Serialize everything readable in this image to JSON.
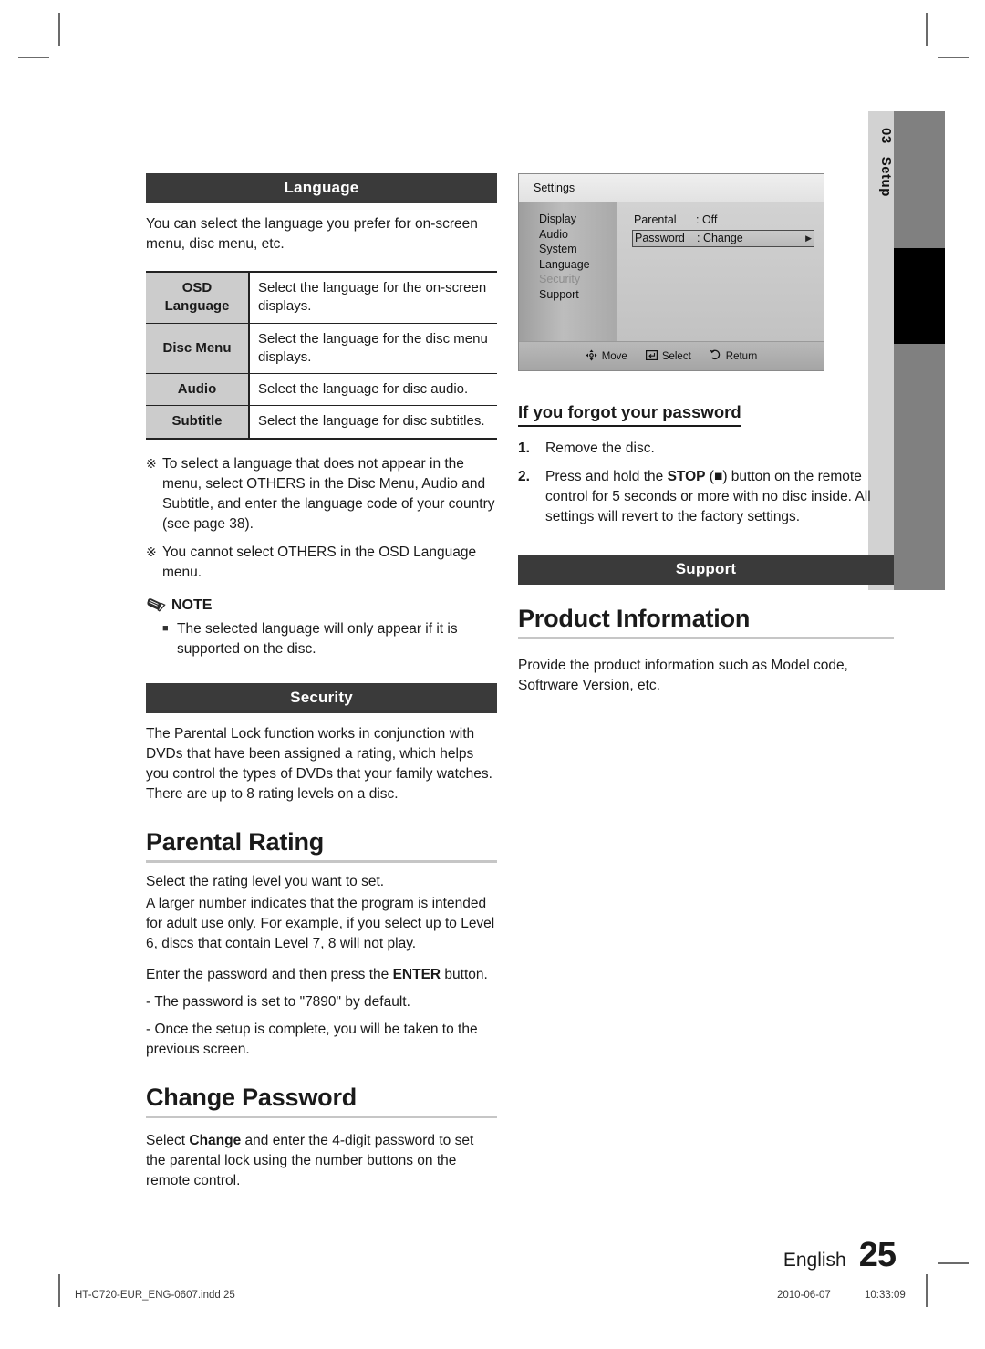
{
  "page": {
    "language_label": "English",
    "number": "25",
    "side_tab_number": "03",
    "side_tab_label": "Setup"
  },
  "print_footer": {
    "file": "HT-C720-EUR_ENG-0607.indd   25",
    "date": "2010-06-07",
    "time": "10:33:09"
  },
  "language_section": {
    "header": "Language",
    "intro": "You can select the language you prefer for on-screen menu, disc menu, etc.",
    "table": [
      {
        "key": "OSD\nLanguage",
        "key_line1": "OSD",
        "key_line2": "Language",
        "value": "Select the language for the on-screen displays."
      },
      {
        "key": "Disc Menu",
        "key_line1": "Disc Menu",
        "key_line2": "",
        "value": "Select the language for the disc menu displays."
      },
      {
        "key": "Audio",
        "key_line1": "Audio",
        "key_line2": "",
        "value": "Select the language for disc audio."
      },
      {
        "key": "Subtitle",
        "key_line1": "Subtitle",
        "key_line2": "",
        "value": "Select the language for disc subtitles."
      }
    ],
    "remarks": [
      {
        "mark": "※",
        "text": "To select a language that does not appear in the menu, select OTHERS in the Disc Menu, Audio and Subtitle, and enter the language code of your country (see page 38)."
      },
      {
        "mark": "※",
        "text": "You cannot select OTHERS in the OSD Language menu."
      }
    ],
    "note_title": "NOTE",
    "note_items": [
      "The selected language will only appear if it is supported on the disc."
    ]
  },
  "security_section": {
    "header": "Security",
    "intro": "The Parental Lock function works in conjunction with DVDs that have been assigned a rating, which helps you control the types of DVDs that your family watches. There are up to 8 rating levels on a disc.",
    "parental_rating": {
      "title": "Parental Rating",
      "p1": "Select the rating level you want to set.",
      "p2": "A larger number indicates that the program is intended for adult use only. For example, if you select up to Level 6, discs that contain Level 7, 8 will not play.",
      "p3_a": "Enter the password and then press the ",
      "p3_kw": "ENTER",
      "p3_b": " button.",
      "p4": "- The password is set to \"7890\" by default.",
      "p5": "- Once the setup is complete, you will be taken to the previous screen."
    },
    "change_password": {
      "title": "Change Password",
      "p_a": "Select ",
      "p_kw": "Change",
      "p_b": " and enter the 4-digit password to set the parental lock using the number buttons on the remote control."
    }
  },
  "settings_screen": {
    "title": "Settings",
    "nav": [
      {
        "label": "Display",
        "dim": false
      },
      {
        "label": "Audio",
        "dim": false
      },
      {
        "label": "System",
        "dim": false
      },
      {
        "label": "Language",
        "dim": false
      },
      {
        "label": "Security",
        "dim": true
      },
      {
        "label": "Support",
        "dim": false
      }
    ],
    "rows": [
      {
        "label": "Parental",
        "value": ": Off",
        "selected": false
      },
      {
        "label": "Password",
        "value": ": Change",
        "selected": true
      }
    ],
    "footer": [
      {
        "icon": "dpad-icon",
        "label": "Move"
      },
      {
        "icon": "enter-key-icon",
        "label": "Select"
      },
      {
        "icon": "return-arrow-icon",
        "label": "Return"
      }
    ]
  },
  "forgot_password": {
    "title": "If you forgot your password",
    "steps": [
      {
        "n": "1.",
        "text": "Remove the disc."
      },
      {
        "n": "2.",
        "text_a": "Press and hold the ",
        "kw": "STOP",
        "text_b": " (■) button on the remote control for 5 seconds or more with no disc inside. All settings will revert to the factory settings."
      }
    ]
  },
  "support_section": {
    "header": "Support",
    "product_information": {
      "title": "Product Information",
      "body": "Provide the product information such as Model code, Softrware Version, etc."
    }
  }
}
